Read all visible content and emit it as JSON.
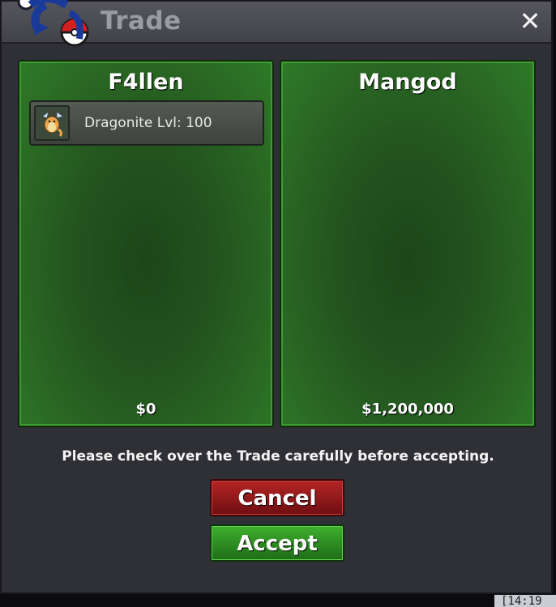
{
  "window": {
    "title": "Trade",
    "close_label": "✕"
  },
  "trade": {
    "left": {
      "player": "F4llen",
      "items": [
        {
          "name": "Dragonite",
          "level_text": "Lvl: 100",
          "icon": "dragonite-icon"
        }
      ],
      "money": "$0"
    },
    "right": {
      "player": "Mangod",
      "items": [],
      "money": "$1,200,000"
    }
  },
  "notice": "Please check over the Trade carefully before accepting.",
  "buttons": {
    "cancel": "Cancel",
    "accept": "Accept"
  },
  "chat": {
    "timestamp": "[14:19"
  },
  "colors": {
    "panel_green": "#2f7a28",
    "cancel_red": "#b52424",
    "accept_green": "#3fb02e",
    "window_bg": "#2f2f36"
  }
}
